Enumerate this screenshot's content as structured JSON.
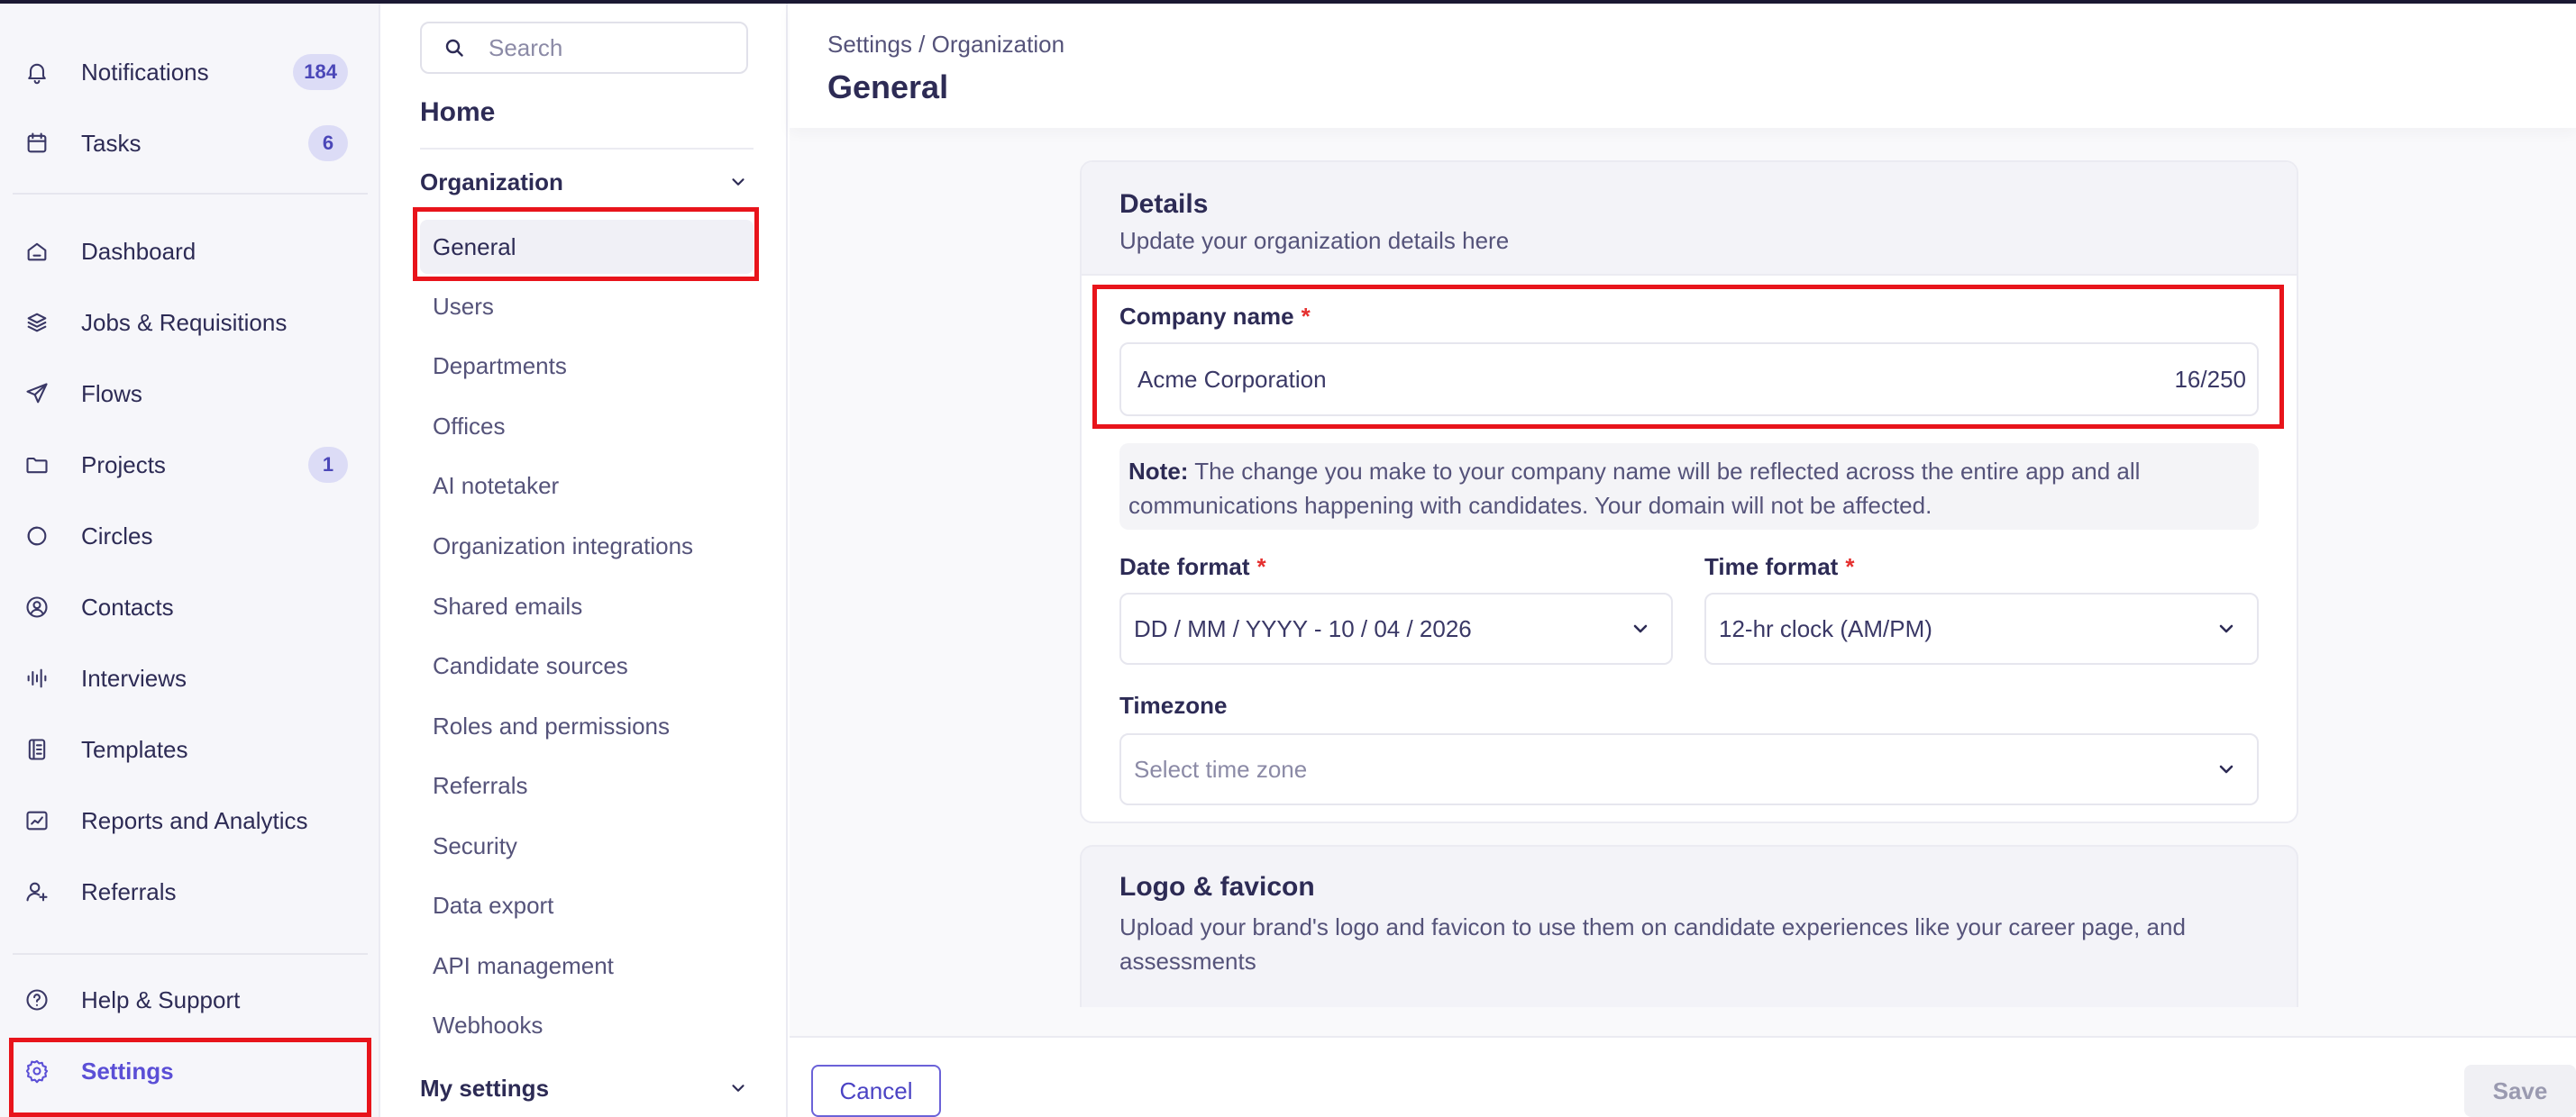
{
  "sidebar": {
    "items": [
      {
        "label": "Notifications",
        "badge": "184",
        "icon": "bell-icon"
      },
      {
        "label": "Tasks",
        "badge": "6",
        "icon": "calendar-icon"
      },
      {
        "label": "Dashboard",
        "icon": "home-icon"
      },
      {
        "label": "Jobs & Requisitions",
        "icon": "layers-icon"
      },
      {
        "label": "Flows",
        "icon": "send-icon"
      },
      {
        "label": "Projects",
        "badge": "1",
        "icon": "folder-icon"
      },
      {
        "label": "Circles",
        "icon": "circles-icon"
      },
      {
        "label": "Contacts",
        "icon": "user-circle-icon"
      },
      {
        "label": "Interviews",
        "icon": "audio-wave-icon"
      },
      {
        "label": "Templates",
        "icon": "template-icon"
      },
      {
        "label": "Reports and Analytics",
        "icon": "chart-icon"
      },
      {
        "label": "Referrals",
        "icon": "user-plus-icon"
      }
    ],
    "help_label": "Help & Support",
    "settings_label": "Settings"
  },
  "subnav": {
    "search_placeholder": "Search",
    "home": "Home",
    "organization_group": "Organization",
    "items": [
      "General",
      "Users",
      "Departments",
      "Offices",
      "AI notetaker",
      "Organization integrations",
      "Shared emails",
      "Candidate sources",
      "Roles and permissions",
      "Referrals",
      "Security",
      "Data export",
      "API management",
      "Webhooks"
    ],
    "my_settings_group": "My settings"
  },
  "header": {
    "breadcrumb": "Settings / Organization",
    "title": "General"
  },
  "details": {
    "title": "Details",
    "subtitle": "Update your organization details here",
    "company_label": "Company name",
    "required_mark": "*",
    "company_value": "Acme Corporation",
    "company_count": "16/250",
    "note_bold": "Note:",
    "note_text": " The change you make to your company name will be reflected across the entire app and all communications happening with candidates. Your domain will not be affected.",
    "date_label": "Date format",
    "date_value": "DD / MM / YYYY - 10 / 04 / 2026",
    "time_label": "Time format",
    "time_value": "12-hr clock (AM/PM)",
    "timezone_label": "Timezone",
    "timezone_placeholder": "Select time zone"
  },
  "logo": {
    "title": "Logo & favicon",
    "subtitle": "Upload your brand's logo and favicon to use them on candidate experiences like your career page, and assessments"
  },
  "footer": {
    "cancel": "Cancel",
    "save": "Save"
  },
  "colors": {
    "accent": "#5b4fd6",
    "highlight": "#e8141b",
    "badge_bg": "#dcdcf6",
    "text": "#2d2b55"
  }
}
